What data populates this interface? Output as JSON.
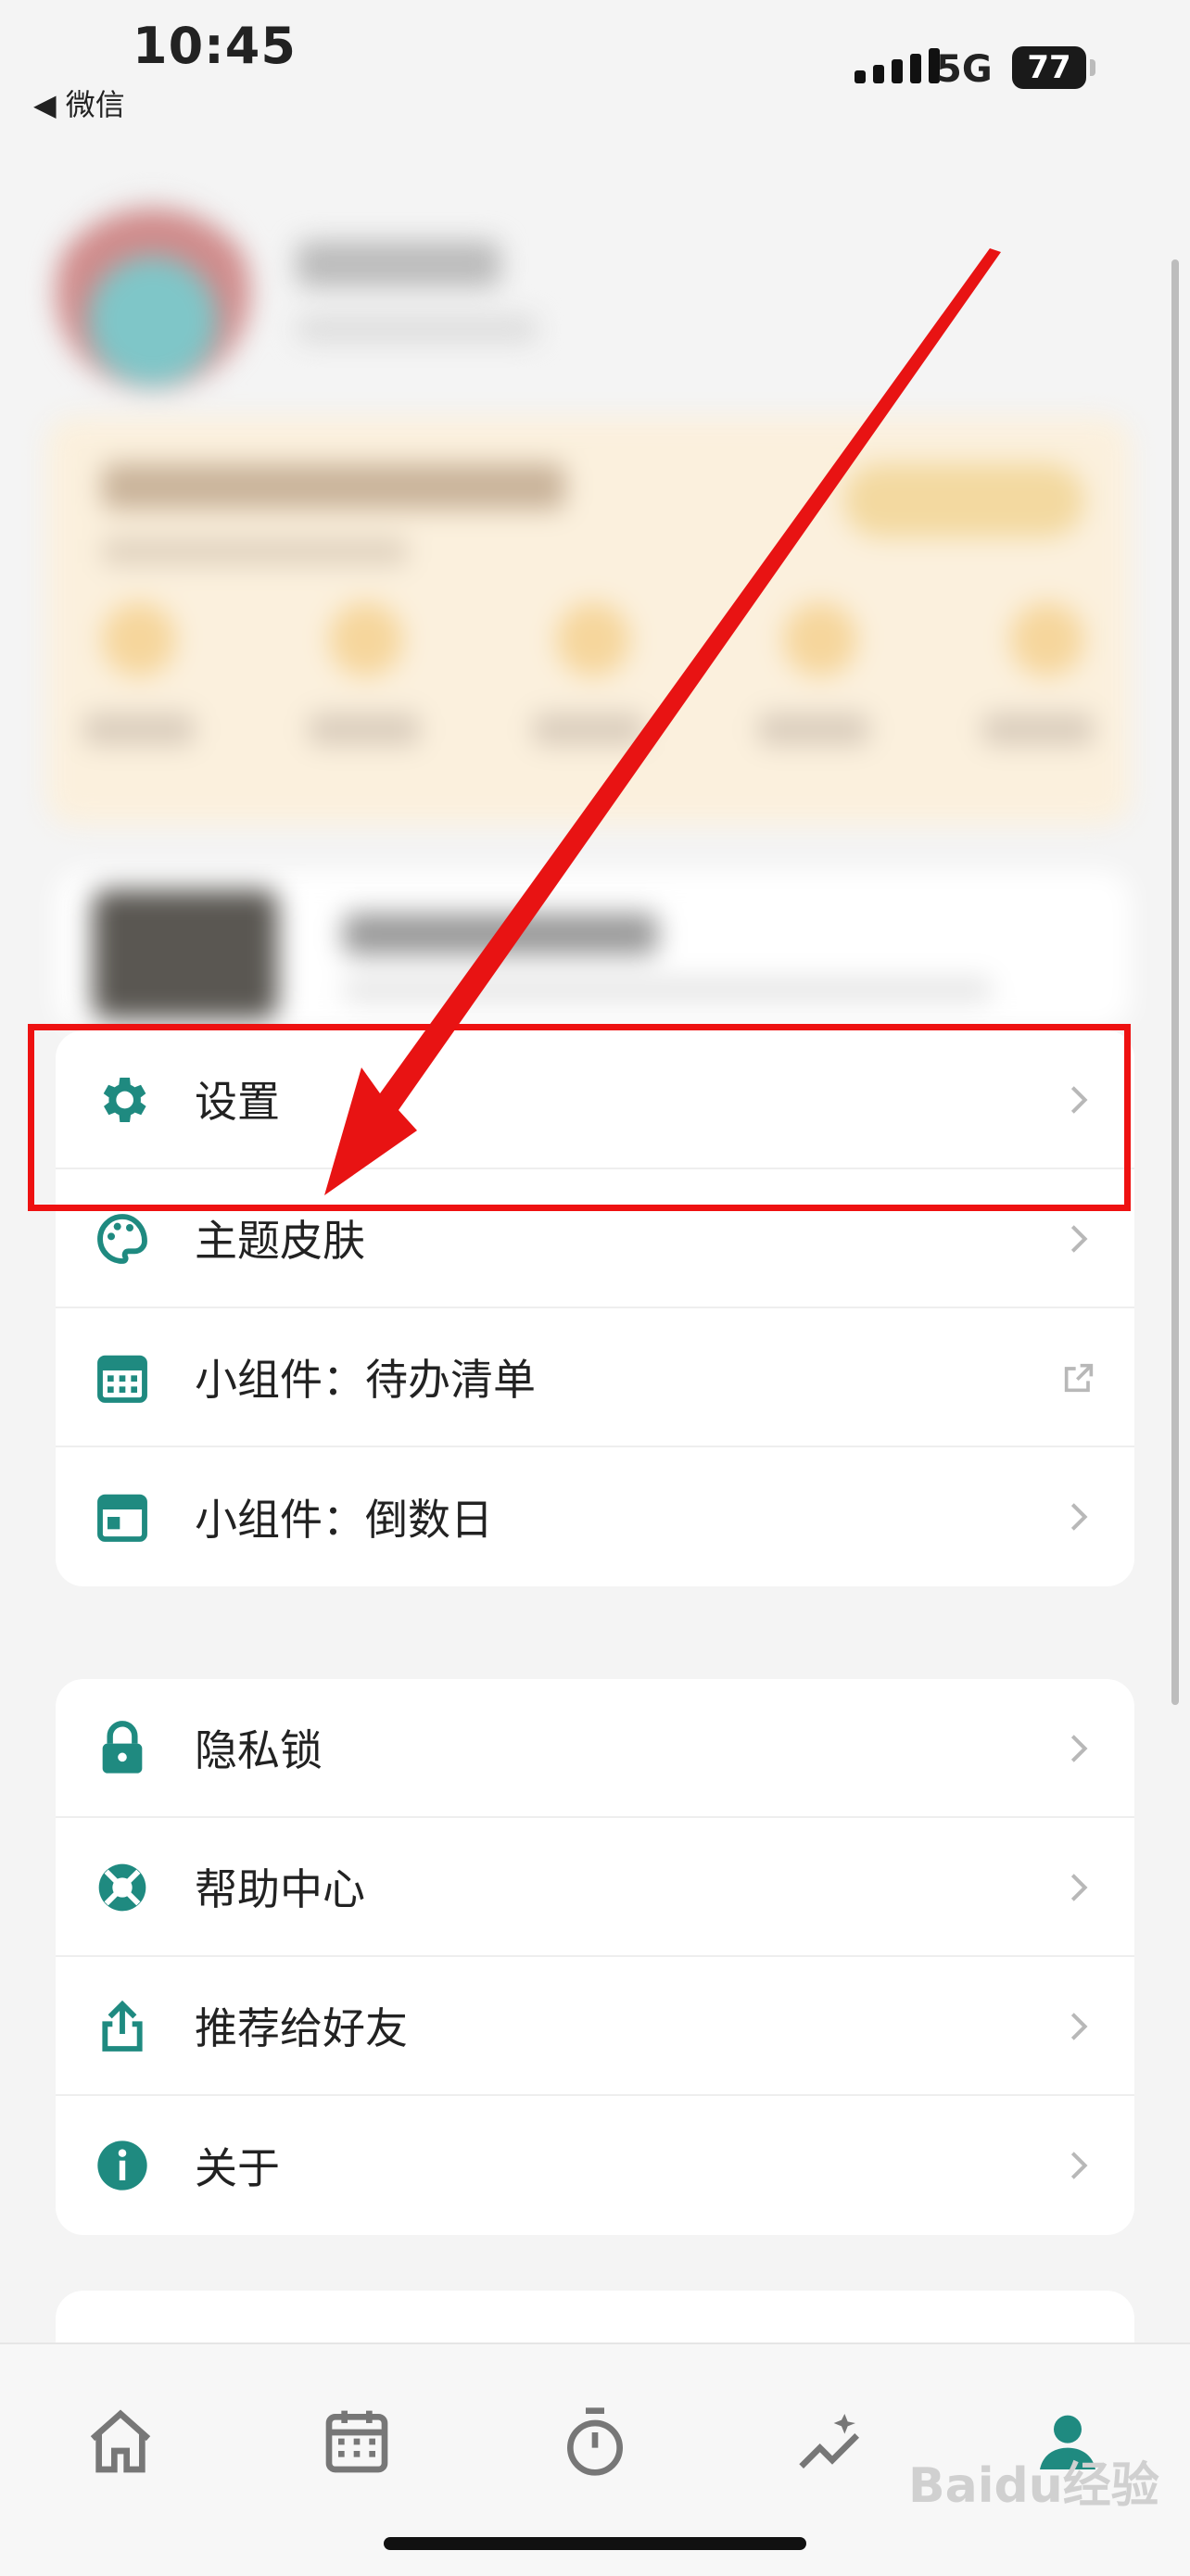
{
  "status_bar": {
    "time": "10:45",
    "back_label": "◀ 微信",
    "network": "5G",
    "battery": "77"
  },
  "menu_card_1": {
    "items": [
      {
        "label": "设置",
        "icon": "gear-icon"
      },
      {
        "label": "主题皮肤",
        "icon": "palette-icon"
      },
      {
        "label": "小组件：待办清单",
        "icon": "calendar-grid-icon"
      },
      {
        "label": "小组件：倒数日",
        "icon": "calendar-icon"
      }
    ]
  },
  "menu_card_2": {
    "items": [
      {
        "label": "隐私锁",
        "icon": "lock-icon"
      },
      {
        "label": "帮助中心",
        "icon": "lifebuoy-icon"
      },
      {
        "label": "推荐给好友",
        "icon": "share-icon"
      },
      {
        "label": "关于",
        "icon": "info-icon"
      }
    ]
  },
  "tab_bar": {
    "tabs": [
      {
        "name": "home-icon"
      },
      {
        "name": "calendar-icon"
      },
      {
        "name": "timer-icon"
      },
      {
        "name": "stats-icon"
      },
      {
        "name": "profile-icon",
        "active": true
      }
    ]
  },
  "watermark": "Baidu经验",
  "colors": {
    "accent": "#1f8a80",
    "highlight": "#ee1111",
    "arrow": "#e81313"
  }
}
